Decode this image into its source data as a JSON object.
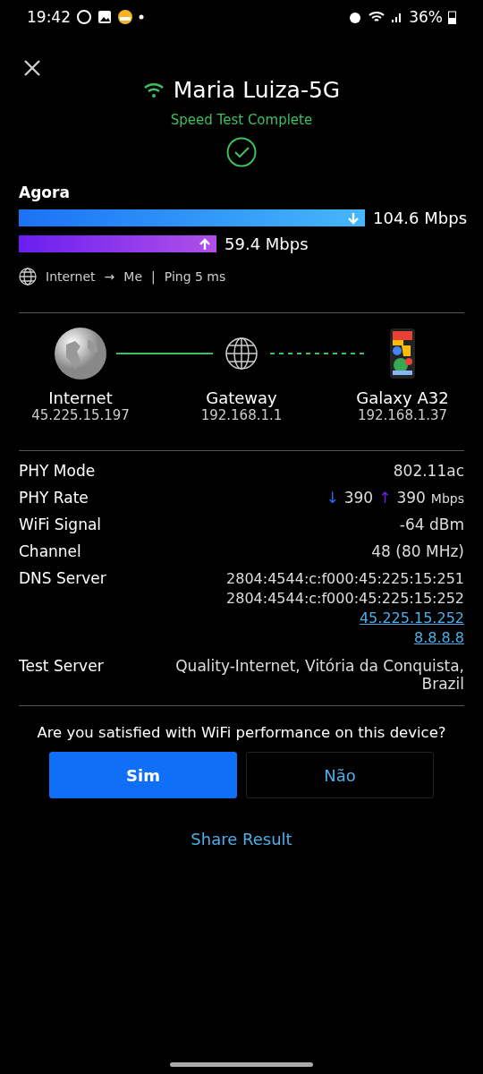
{
  "status_bar": {
    "time": "19:42",
    "battery": "36%"
  },
  "header": {
    "network": "Maria Luiza-5G",
    "status": "Speed Test Complete"
  },
  "speed": {
    "title": "Agora",
    "bars": [
      {
        "kind": "download",
        "reading": "104.6 Mbps"
      },
      {
        "kind": "upload",
        "reading": "59.4 Mbps"
      }
    ],
    "route": {
      "from": "Internet",
      "arrow": "→",
      "to": "Me",
      "separator": "|",
      "ping": "Ping 5 ms"
    }
  },
  "topology": [
    {
      "kind": "internet",
      "name": "Internet",
      "ip": "45.225.15.197"
    },
    {
      "kind": "gateway",
      "name": "Gateway",
      "ip": "192.168.1.1"
    },
    {
      "kind": "device",
      "name": "Galaxy A32",
      "ip": "192.168.1.37"
    }
  ],
  "details": [
    {
      "kind": "text",
      "label": "PHY Mode",
      "value": "802.11ac"
    },
    {
      "kind": "rate",
      "label": "PHY Rate",
      "down_arrow": "↓",
      "down": "390",
      "up_arrow": "↑",
      "up": "390",
      "unit": "Mbps"
    },
    {
      "kind": "text",
      "label": "WiFi Signal",
      "value": "-64 dBm"
    },
    {
      "kind": "text",
      "label": "Channel",
      "value": "48 (80 MHz)"
    },
    {
      "kind": "lines",
      "label": "DNS Server",
      "lines": [
        {
          "text": "2804:4544:c:f000:45:225:15:251",
          "link": false
        },
        {
          "text": "2804:4544:c:f000:45:225:15:252",
          "link": false
        },
        {
          "text": "45.225.15.252",
          "link": true
        },
        {
          "text": "8.8.8.8",
          "link": true
        }
      ]
    },
    {
      "kind": "text",
      "label": "Test Server",
      "value": "Quality-Internet, Vitória da Conquista, Brazil"
    }
  ],
  "survey": {
    "question": "Are you satisfied with WiFi performance on this device?",
    "options": [
      {
        "label": "Sim",
        "selected": true
      },
      {
        "label": "Não",
        "selected": false
      }
    ]
  },
  "share": "Share Result"
}
